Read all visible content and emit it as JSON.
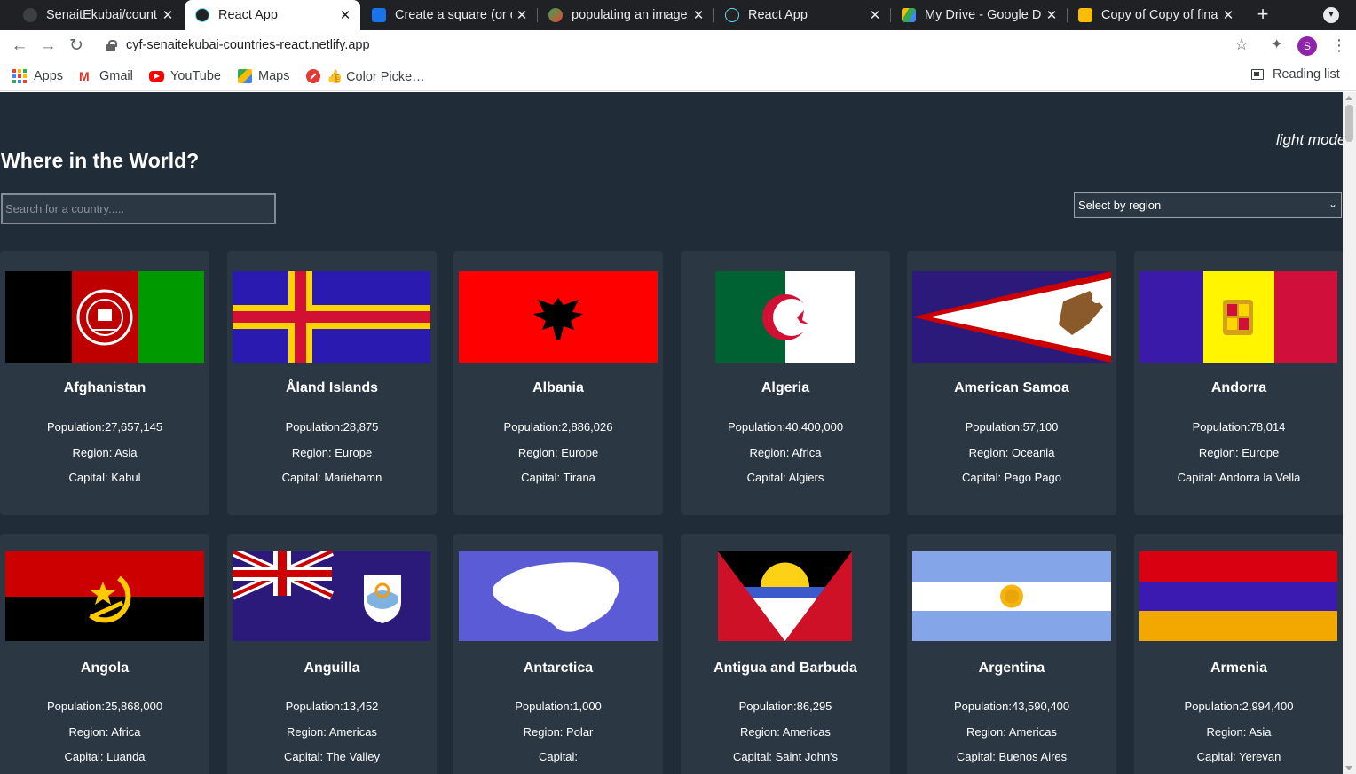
{
  "browser": {
    "tabs": [
      {
        "title": "SenaitEkubai/countries-react",
        "active": false,
        "favicon": "github-icon"
      },
      {
        "title": "React App",
        "active": true,
        "favicon": "react-icon"
      },
      {
        "title": "Create a square (or circle)",
        "active": false,
        "favicon": "video-icon"
      },
      {
        "title": "populating an image",
        "active": false,
        "favicon": "spark-icon"
      },
      {
        "title": "React App",
        "active": false,
        "favicon": "react-icon"
      },
      {
        "title": "My Drive - Google Drive",
        "active": false,
        "favicon": "drive-icon"
      },
      {
        "title": "Copy of Copy of final",
        "active": false,
        "favicon": "slides-icon"
      }
    ],
    "new_tab": "+",
    "url": "cyf-senaitekubai-countries-react.netlify.app",
    "profile_initial": "S",
    "bookmarks": [
      {
        "label": "Apps",
        "icon": "apps-grid-icon"
      },
      {
        "label": "Gmail",
        "icon": "gmail-icon"
      },
      {
        "label": "YouTube",
        "icon": "youtube-icon"
      },
      {
        "label": "Maps",
        "icon": "maps-icon"
      },
      {
        "label": "👍 Color Picke…",
        "icon": "color-picker-icon"
      }
    ],
    "reading_list": "Reading list"
  },
  "page": {
    "mode_toggle": "light mode",
    "title": "Where in the World?",
    "search_placeholder": "Search for a country.....",
    "region_select": "Select by region",
    "population_prefix": "Population:",
    "region_prefix": "Region: ",
    "capital_prefix": "Capital: "
  },
  "countries": [
    {
      "name": "Afghanistan",
      "population": "Population:27,657,145",
      "region": "Region: Asia",
      "capital": "Capital: Kabul",
      "flag": "afghanistan"
    },
    {
      "name": "Åland Islands",
      "population": "Population:28,875",
      "region": "Region: Europe",
      "capital": "Capital: Mariehamn",
      "flag": "aland"
    },
    {
      "name": "Albania",
      "population": "Population:2,886,026",
      "region": "Region: Europe",
      "capital": "Capital: Tirana",
      "flag": "albania"
    },
    {
      "name": "Algeria",
      "population": "Population:40,400,000",
      "region": "Region: Africa",
      "capital": "Capital: Algiers",
      "flag": "algeria"
    },
    {
      "name": "American Samoa",
      "population": "Population:57,100",
      "region": "Region: Oceania",
      "capital": "Capital: Pago Pago",
      "flag": "american-samoa"
    },
    {
      "name": "Andorra",
      "population": "Population:78,014",
      "region": "Region: Europe",
      "capital": "Capital: Andorra la Vella",
      "flag": "andorra"
    },
    {
      "name": "Angola",
      "population": "Population:25,868,000",
      "region": "Region: Africa",
      "capital": "Capital: Luanda",
      "flag": "angola"
    },
    {
      "name": "Anguilla",
      "population": "Population:13,452",
      "region": "Region: Americas",
      "capital": "Capital: The Valley",
      "flag": "anguilla"
    },
    {
      "name": "Antarctica",
      "population": "Population:1,000",
      "region": "Region: Polar",
      "capital": "Capital:",
      "flag": "antarctica"
    },
    {
      "name": "Antigua and Barbuda",
      "population": "Population:86,295",
      "region": "Region: Americas",
      "capital": "Capital: Saint John's",
      "flag": "antigua"
    },
    {
      "name": "Argentina",
      "population": "Population:43,590,400",
      "region": "Region: Americas",
      "capital": "Capital: Buenos Aires",
      "flag": "argentina"
    },
    {
      "name": "Armenia",
      "population": "Population:2,994,400",
      "region": "Region: Asia",
      "capital": "Capital: Yerevan",
      "flag": "armenia"
    }
  ],
  "colors": {
    "page_bg": "#202c37",
    "card_bg": "#2b3743",
    "text": "#ffffff"
  }
}
